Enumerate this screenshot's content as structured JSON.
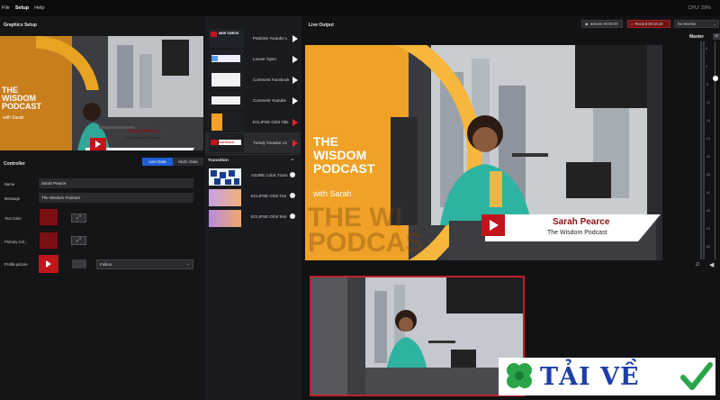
{
  "menu": {
    "file": "File",
    "setup": "Setup",
    "help": "Help",
    "cpu": "CPU: 29%"
  },
  "graphics_setup": {
    "title": "Graphics Setup"
  },
  "small_preview": {
    "big_text": [
      "THE",
      "WISDOM",
      "PODCAST"
    ],
    "with_text": "with Sarah",
    "name": "Sarah Pearce",
    "show": "The Wisdom Podcast"
  },
  "controller": {
    "title": "Controller",
    "tabs": [
      "Live Data",
      "Multi. Data"
    ],
    "fields": [
      {
        "label": "Name",
        "value": "Sarah Pearce"
      },
      {
        "label": "Message",
        "value": "The Wisdom Podcast"
      }
    ],
    "text_color_label": "Text Color",
    "primary_color_label": "Primary Col...",
    "profile_picture_label": "Profile picture",
    "fill_select": "Fullion",
    "swatch_color": "#7b1014"
  },
  "graphics_list": [
    {
      "label": "Particles Youtube L",
      "thumb": "NEW VIDEOS"
    },
    {
      "label": "Louver Open",
      "thumb": ""
    },
    {
      "label": "Comment Facebook",
      "thumb": ""
    },
    {
      "label": "Comment Youtube",
      "thumb": ""
    },
    {
      "label": "ECLIPSE Orbit Title",
      "thumb": ""
    },
    {
      "label": "Trendy Youtube L3",
      "thumb": "SARTPIECE"
    }
  ],
  "transition": {
    "title": "Transition",
    "items": [
      {
        "label": "AZURE Cubic Trans"
      },
      {
        "label": "ECLIPSE Orbit Trar"
      },
      {
        "label": "ECLIPSE Orbit Text"
      }
    ]
  },
  "live_output": {
    "title": "Live Output",
    "stream_btn": "Stream 00:00:00",
    "record_btn": "Record 00:16:24",
    "monitor_select": "No Monitor",
    "master_label": "Master"
  },
  "main_preview": {
    "big_text": [
      "THE",
      "WISDOM",
      "PODCAST"
    ],
    "with_text": "with Sarah",
    "ghost_text": [
      "THE WI",
      "PODCAS"
    ],
    "name": "Sarah Pearce",
    "show": "The Wisdom Podcast"
  },
  "meter_scale": [
    "6",
    "0",
    "-6",
    "-12",
    "-18",
    "-24",
    "-30",
    "-36",
    "-42",
    "-48",
    "-54",
    "-60"
  ],
  "watermark": {
    "text": "TẢI VỀ"
  },
  "colors": {
    "accent": "#1f5fd6",
    "record": "#c22126",
    "orange": "#f39c12"
  }
}
